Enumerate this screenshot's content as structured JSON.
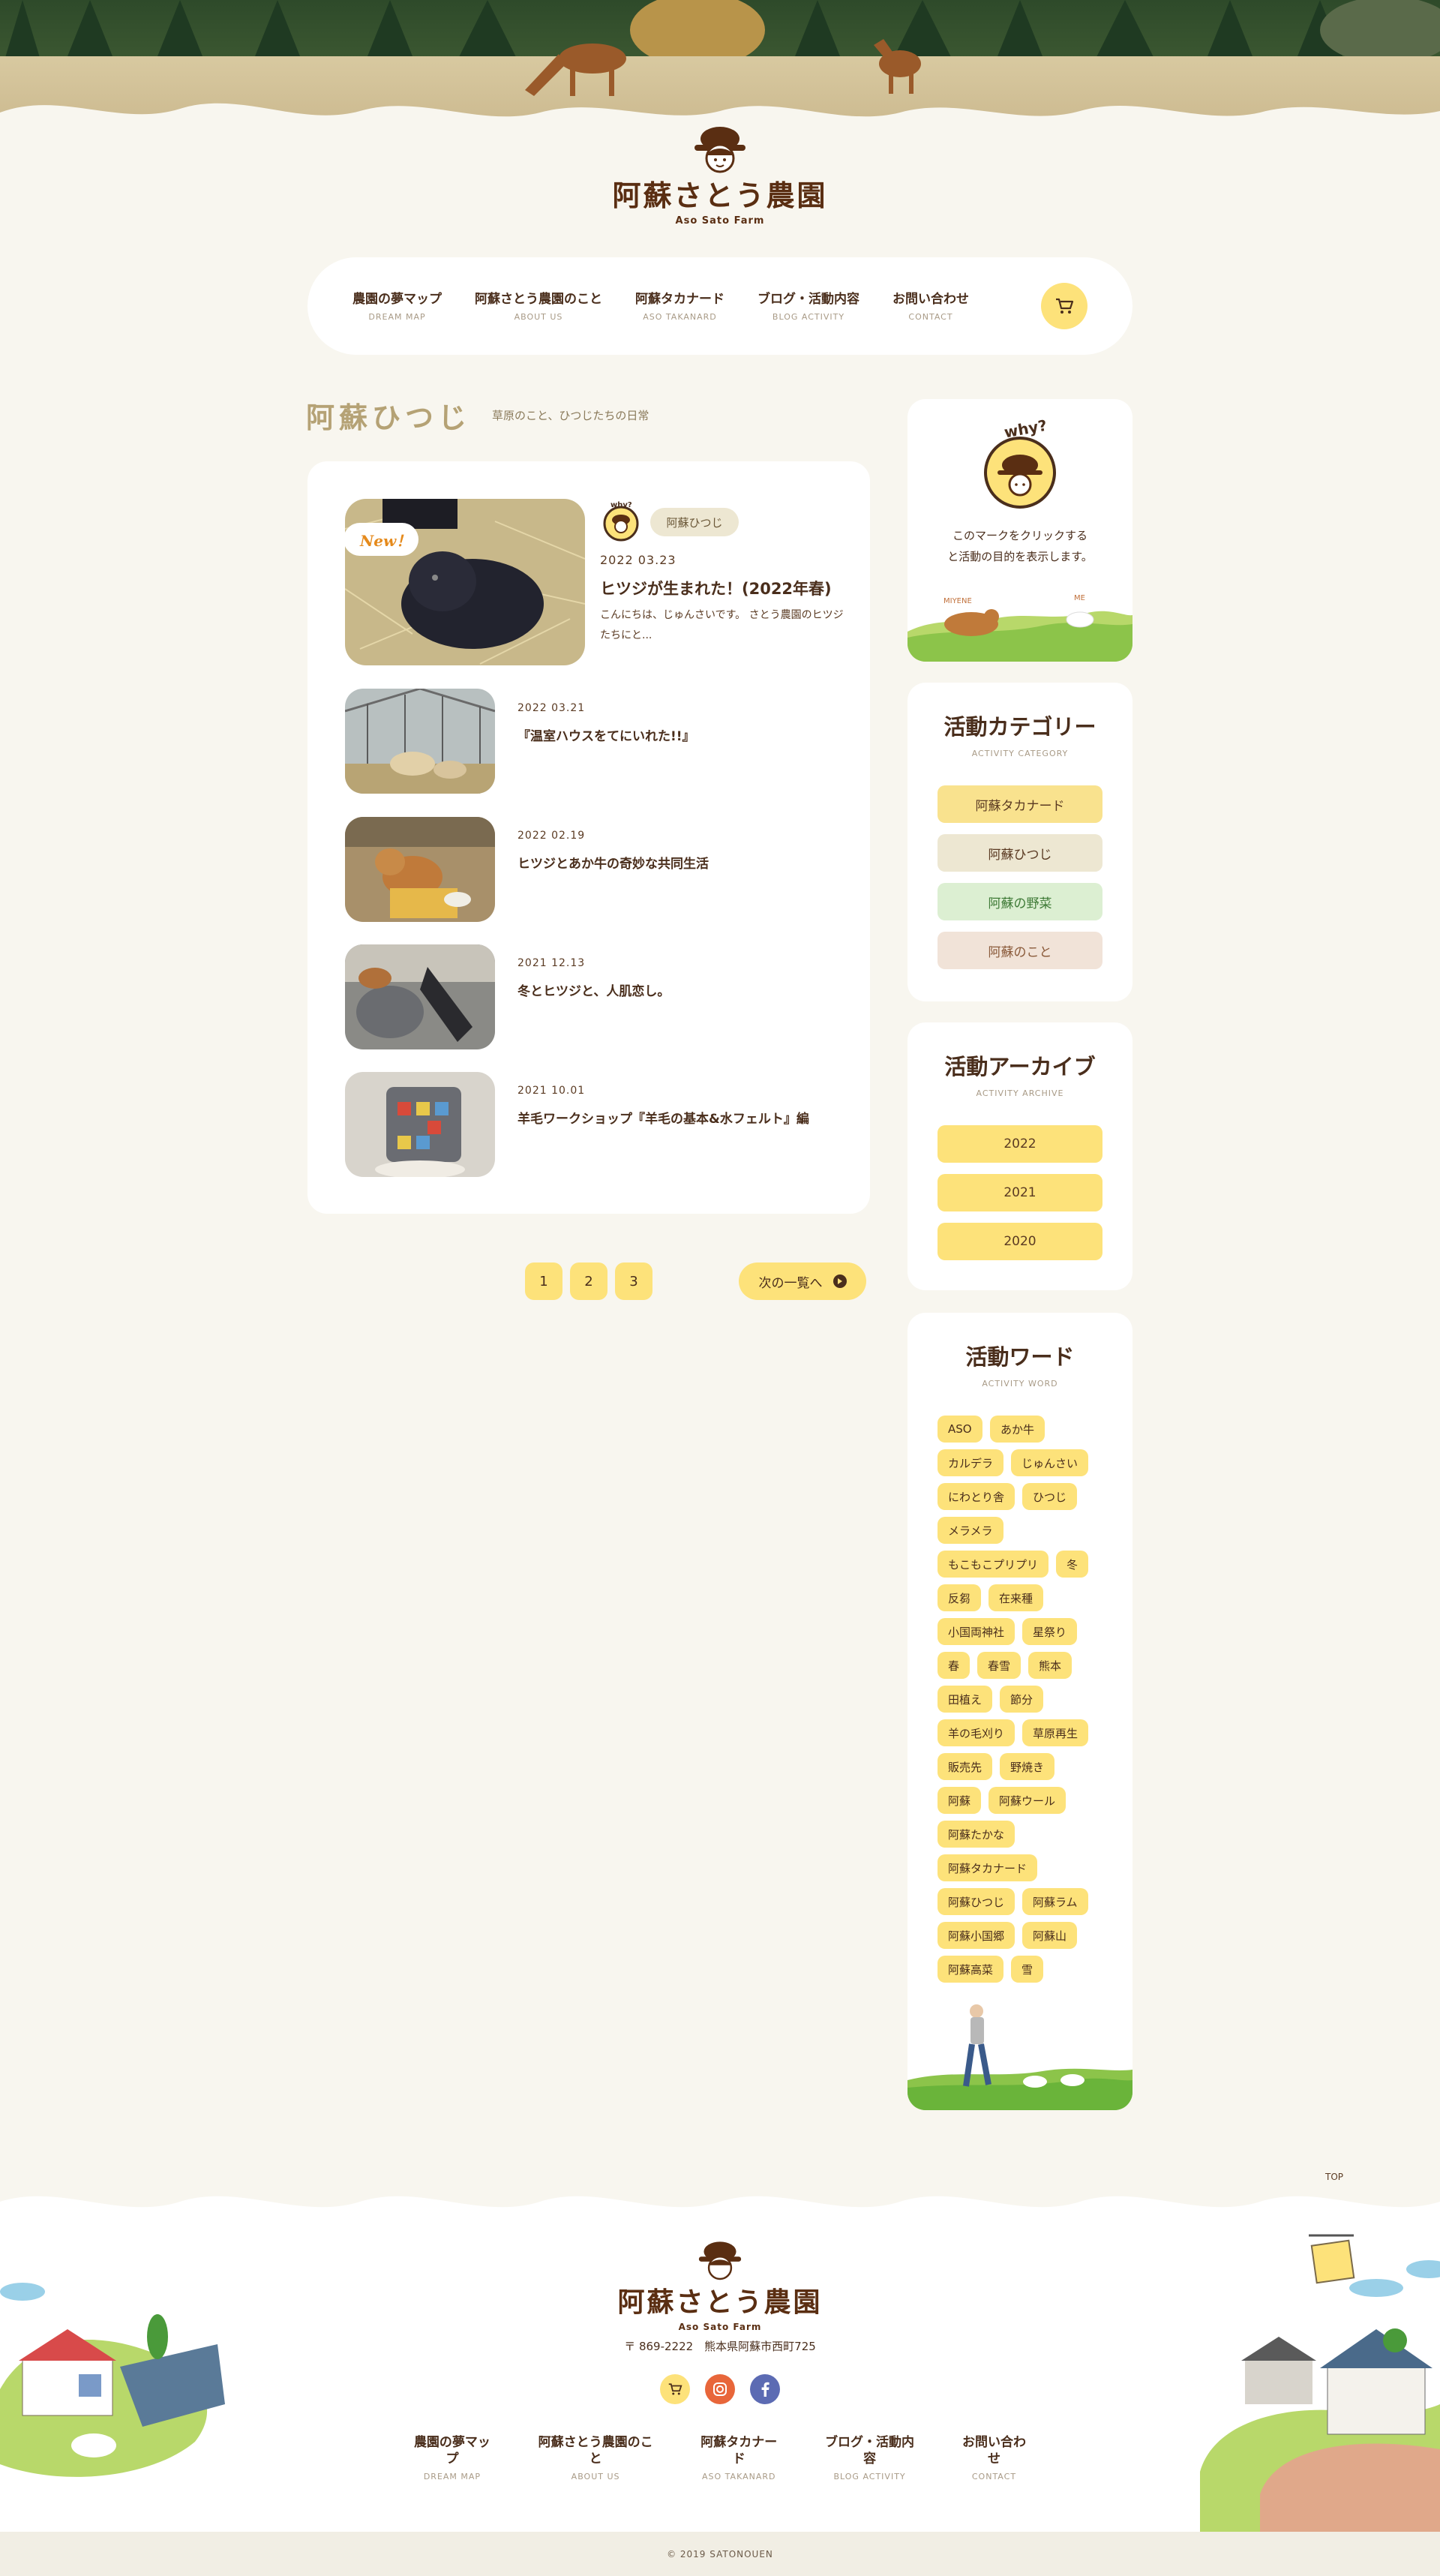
{
  "brand": {
    "name": "阿蘇さとう農園",
    "sub": "Aso Sato Farm",
    "why_label": "why?"
  },
  "nav": [
    {
      "jp": "農園の夢マップ",
      "en": "DREAM MAP"
    },
    {
      "jp": "阿蘇さとう農園のこと",
      "en": "ABOUT US"
    },
    {
      "jp": "阿蘇タカナード",
      "en": "ASO TAKANARD"
    },
    {
      "jp": "ブログ・活動内容",
      "en": "BLOG ACTIVITY"
    },
    {
      "jp": "お問い合わせ",
      "en": "CONTACT"
    }
  ],
  "page": {
    "title": "阿蘇ひつじ",
    "subtitle": "草原のこと、ひつじたちの日常"
  },
  "featured": {
    "badge": "New！",
    "category": "阿蘇ひつじ",
    "date": "2022 03.23",
    "title": "ヒツジが生まれた！(2022年春)",
    "excerpt": "こんにちは、じゅんさいです。 さとう農園のヒツジたちにと..."
  },
  "posts": [
    {
      "date": "2022 03.21",
      "title": "『温室ハウスをてにいれた!!』"
    },
    {
      "date": "2022 02.19",
      "title": "ヒツジとあか牛の奇妙な共同生活"
    },
    {
      "date": "2021 12.13",
      "title": "冬とヒツジと、人肌恋し。"
    },
    {
      "date": "2021 10.01",
      "title": "羊毛ワークショップ『羊毛の基本&水フェルト』編"
    }
  ],
  "pagination": {
    "pages": [
      "1",
      "2",
      "3"
    ],
    "next": "次の一覧へ"
  },
  "why_card": {
    "line1": "このマークをクリックする",
    "line2": "と活動の目的を表示します。",
    "sign_left": "MIYENE",
    "sign_right": "ME"
  },
  "category": {
    "title": "活動カテゴリー",
    "en": "ACTIVITY CATEGORY",
    "items": [
      "阿蘇タカナード",
      "阿蘇ひつじ",
      "阿蘇の野菜",
      "阿蘇のこと"
    ]
  },
  "archive": {
    "title": "活動アーカイブ",
    "en": "ACTIVITY ARCHIVE",
    "items": [
      "2022",
      "2021",
      "2020"
    ]
  },
  "words": {
    "title": "活動ワード",
    "en": "ACTIVITY WORD",
    "rows": [
      [
        "ASO",
        "あか牛"
      ],
      [
        "カルデラ",
        "じゅんさい"
      ],
      [
        "にわとり舎",
        "ひつじ"
      ],
      [
        "メラメラ"
      ],
      [
        "もこもこプリプリ",
        "冬"
      ],
      [
        "反芻",
        "在来種"
      ],
      [
        "小国両神社",
        "星祭り"
      ],
      [
        "春",
        "春雪",
        "熊本"
      ],
      [
        "田植え",
        "節分"
      ],
      [
        "羊の毛刈り",
        "草原再生"
      ],
      [
        "販売先",
        "野焼き"
      ],
      [
        "阿蘇",
        "阿蘇ウール"
      ],
      [
        "阿蘇たかな"
      ],
      [
        "阿蘇タカナード"
      ],
      [
        "阿蘇ひつじ",
        "阿蘇ラム"
      ],
      [
        "阿蘇小国郷",
        "阿蘇山"
      ],
      [
        "阿蘇高菜",
        "雪"
      ]
    ]
  },
  "footer": {
    "top": "TOP",
    "address": "〒 869-2222　熊本県阿蘇市西町725",
    "copyright": "© 2019 SATONOUEN"
  },
  "colors": {
    "background": "#f8f6ef",
    "accent_yellow": "#fde27a",
    "brown": "#5a2e12",
    "cat_takanard": "#f9e28e",
    "cat_hitsuji": "#ede7d2",
    "cat_yasai": "#dcefd2",
    "cat_koto": "#f1e3d8",
    "instagram": "#e8663a",
    "facebook": "#5c6bb3"
  },
  "icons": [
    "cart-icon",
    "arrow-right-icon",
    "instagram-icon",
    "facebook-icon",
    "farmer-logo-icon"
  ]
}
